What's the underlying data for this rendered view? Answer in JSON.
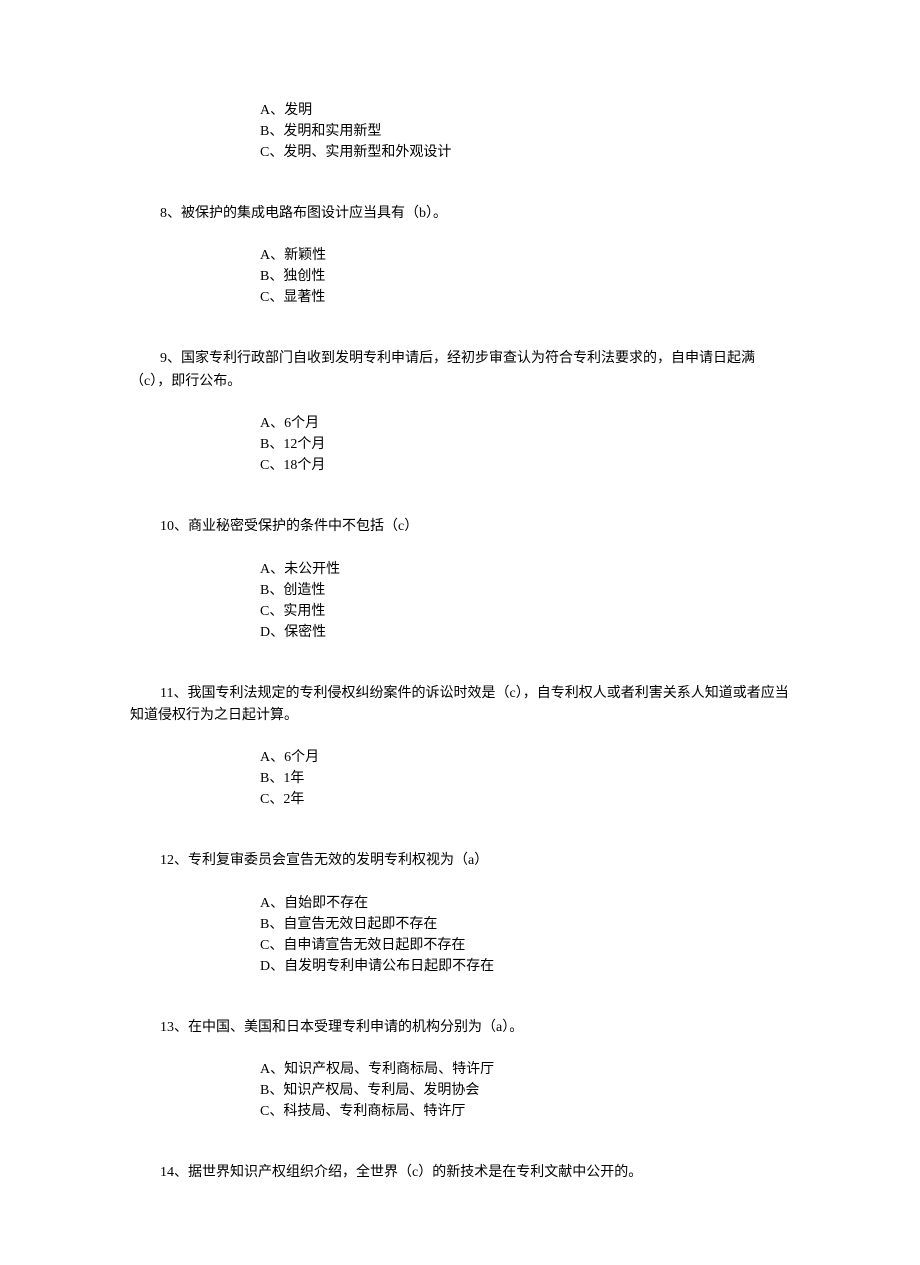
{
  "q7": {
    "options": [
      "A、发明",
      "B、发明和实用新型",
      "C、发明、实用新型和外观设计"
    ]
  },
  "q8": {
    "text": "8、被保护的集成电路布图设计应当具有（b）。",
    "options": [
      "A、新颖性",
      "B、独创性",
      "C、显著性"
    ]
  },
  "q9": {
    "text": "9、国家专利行政部门自收到发明专利申请后，经初步审查认为符合专利法要求的，自申请日起满（c），即行公布。",
    "options": [
      "A、6个月",
      "B、12个月",
      "C、18个月"
    ]
  },
  "q10": {
    "text": "10、商业秘密受保护的条件中不包括（c）",
    "options": [
      "A、未公开性",
      "B、创造性",
      "C、实用性",
      "D、保密性"
    ]
  },
  "q11": {
    "text": "11、我国专利法规定的专利侵权纠纷案件的诉讼时效是（c），自专利权人或者利害关系人知道或者应当知道侵权行为之日起计算。",
    "options": [
      "A、6个月",
      "B、1年",
      "C、2年"
    ]
  },
  "q12": {
    "text": "12、专利复审委员会宣告无效的发明专利权视为（a）",
    "options": [
      "A、自始即不存在",
      "B、自宣告无效日起即不存在",
      "C、自申请宣告无效日起即不存在",
      "D、自发明专利申请公布日起即不存在"
    ]
  },
  "q13": {
    "text": "13、在中国、美国和日本受理专利申请的机构分别为（a）。",
    "options": [
      "A、知识产权局、专利商标局、特许厅",
      "B、知识产权局、专利局、发明协会",
      "C、科技局、专利商标局、特许厅"
    ]
  },
  "q14": {
    "text": "14、据世界知识产权组织介绍，全世界（c）的新技术是在专利文献中公开的。"
  }
}
